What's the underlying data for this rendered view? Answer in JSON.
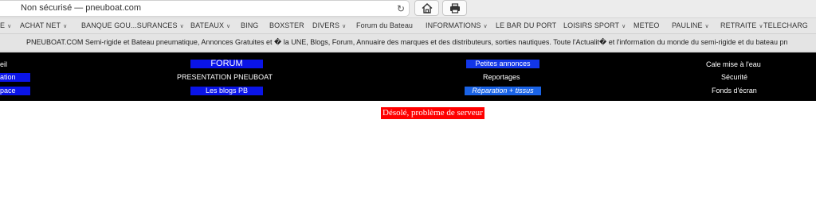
{
  "browser": {
    "address": "Non sécurisé — pneuboat.com"
  },
  "bookmarks": [
    {
      "label": "E",
      "menu": true
    },
    {
      "label": "ACHAT NET",
      "menu": true
    },
    {
      "label": "BANQUE GOU...SURANCES",
      "menu": true
    },
    {
      "label": "BATEAUX",
      "menu": true
    },
    {
      "label": "BING",
      "menu": false
    },
    {
      "label": "BOXSTER",
      "menu": false
    },
    {
      "label": "DIVERS",
      "menu": true
    },
    {
      "label": "Forum du Bateau",
      "menu": false
    },
    {
      "label": "INFORMATIONS",
      "menu": true
    },
    {
      "label": "LE BAR DU PORT",
      "menu": false
    },
    {
      "label": "LOISIRS SPORT",
      "menu": true
    },
    {
      "label": "METEO",
      "menu": false
    },
    {
      "label": "PAULINE",
      "menu": true
    },
    {
      "label": "RETRAITE",
      "menu": true
    },
    {
      "label": "TELECHARG",
      "menu": false
    }
  ],
  "marquee": "PNEUBOAT.COM Semi-rigide et Bateau pneumatique, Annonces Gratuites et � la UNE, Blogs, Forum, Annuaire des marques et des distributeurs, sorties nautiques. Toute l'Actualit� et l'information du monde du semi-rigide et du bateau pn",
  "nav": {
    "col1": [
      "eil",
      "ation",
      "pace"
    ],
    "forum": "FORUM",
    "presentation": "PRESENTATION PNEUBOAT",
    "blogs": "Les blogs   PB",
    "petites_annonces": "Petites annonces",
    "reportages": "Reportages",
    "reparation": "Réparation + tissus",
    "cale": "Cale mise à l'eau",
    "securite": "Sécurité",
    "fonds": "Fonds d'écran"
  },
  "error": "Désolé, problème de serveur",
  "colors": {
    "nav_bg": "#000000",
    "blue_box": "#0a14e8",
    "error_bg": "#ff0000"
  }
}
